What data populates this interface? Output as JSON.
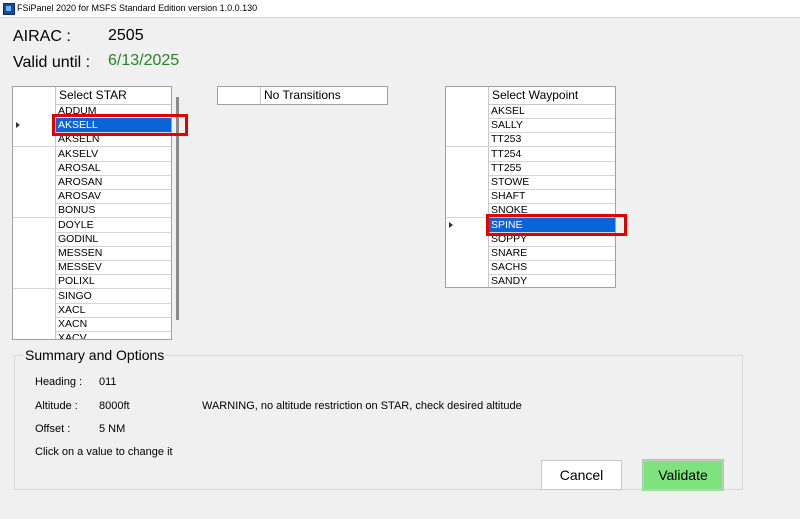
{
  "window": {
    "title": "FSiPanel 2020 for MSFS Standard Edition version 1.0.0.130"
  },
  "header": {
    "airac_label": "AIRAC :",
    "airac_value": "2505",
    "valid_label": "Valid until :",
    "valid_value": "6/13/2025",
    "valid_color": "#1e8a1e"
  },
  "star_list": {
    "header": "Select STAR",
    "selected_index": 1,
    "items": [
      "ADDUM",
      "AKSELL",
      "AKSELN",
      "AKSELV",
      "AROSAL",
      "AROSAN",
      "AROSAV",
      "BONUS",
      "DOYLE",
      "GODINL",
      "MESSEN",
      "MESSEV",
      "POLIXL",
      "SINGO",
      "XACL",
      "XACN",
      "XACV"
    ]
  },
  "transitions": {
    "header": "No Transitions"
  },
  "waypoint_list": {
    "header": "Select Waypoint",
    "selected_index": 8,
    "items": [
      "AKSEL",
      "SALLY",
      "TT253",
      "TT254",
      "TT255",
      "STOWE",
      "SHAFT",
      "SNOKE",
      "SPINE",
      "SOPPY",
      "SNARE",
      "SACHS",
      "SANDY"
    ]
  },
  "summary": {
    "title": "Summary and Options",
    "heading_label": "Heading :",
    "heading_value": "011",
    "altitude_label": "Altitude :",
    "altitude_value": "8000ft",
    "warning": "WARNING, no altitude restriction on STAR, check desired altitude",
    "offset_label": "Offset  :",
    "offset_value": "5 NM",
    "hint": "Click on a value to change it"
  },
  "buttons": {
    "cancel": "Cancel",
    "validate": "Validate"
  },
  "colors": {
    "selection": "#0a64d8",
    "highlight_box": "#e00000",
    "validate_bg": "#7ee27e"
  }
}
